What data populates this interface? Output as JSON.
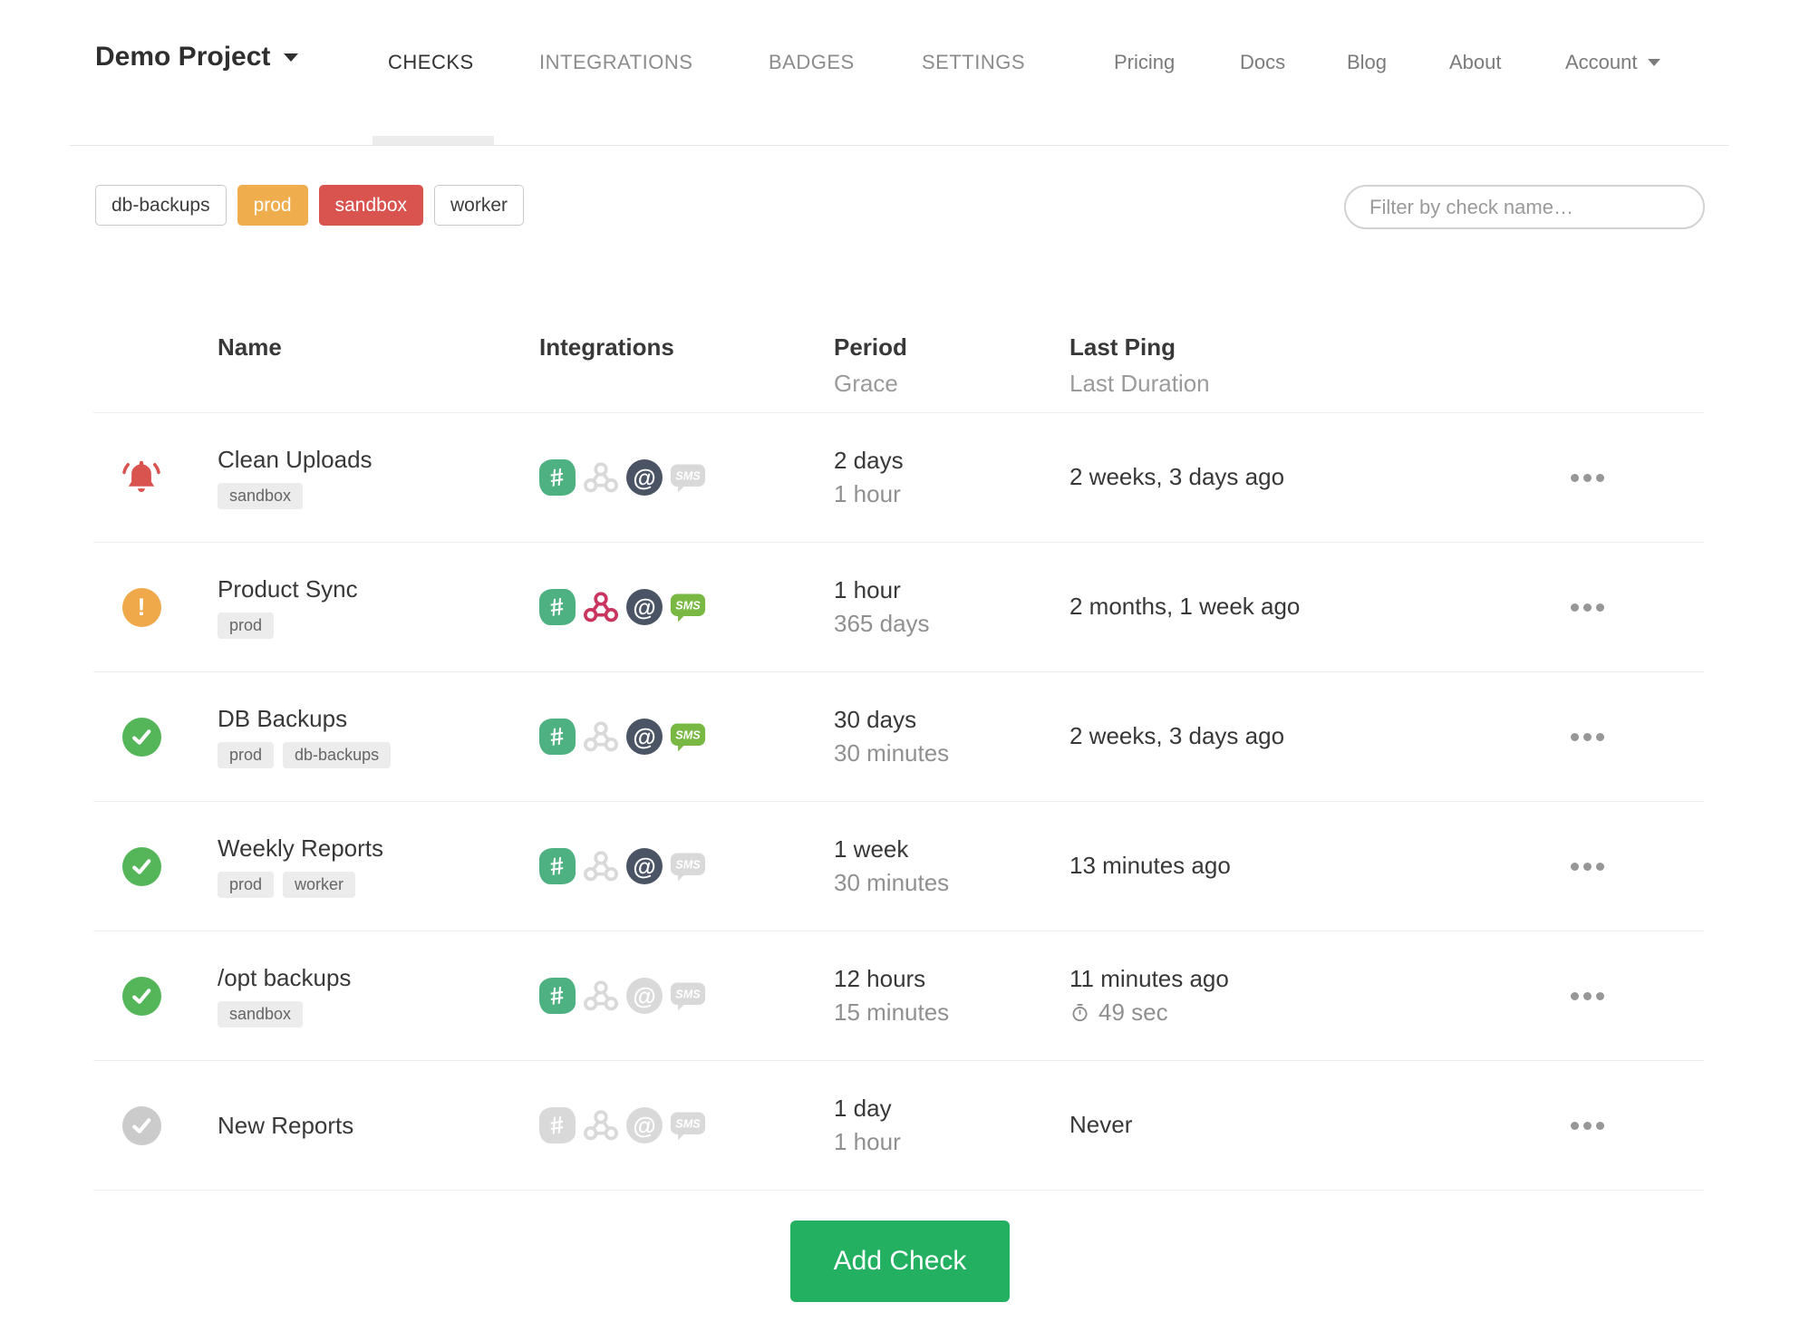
{
  "header": {
    "project": "Demo Project",
    "tabs": [
      "CHECKS",
      "INTEGRATIONS",
      "BADGES",
      "SETTINGS"
    ],
    "active_tab": "CHECKS",
    "links": [
      "Pricing",
      "Docs",
      "Blog",
      "About"
    ],
    "account_label": "Account"
  },
  "filters": {
    "tag_buttons": [
      {
        "label": "db-backups",
        "variant": "outline"
      },
      {
        "label": "prod",
        "variant": "orange"
      },
      {
        "label": "sandbox",
        "variant": "red"
      },
      {
        "label": "worker",
        "variant": "outline"
      }
    ],
    "search_placeholder": "Filter by check name…"
  },
  "table": {
    "headers": {
      "name": "Name",
      "integrations": "Integrations",
      "period": "Period",
      "grace": "Grace",
      "last_ping": "Last Ping",
      "last_duration": "Last Duration"
    },
    "rows": [
      {
        "status": "alert",
        "name": "Clean Uploads",
        "tags": [
          "sandbox"
        ],
        "integrations": {
          "slack": true,
          "webhook": false,
          "email": true,
          "sms": false
        },
        "period": "2 days",
        "grace": "1 hour",
        "last_ping": "2 weeks, 3 days ago",
        "last_duration": ""
      },
      {
        "status": "warning",
        "name": "Product Sync",
        "tags": [
          "prod"
        ],
        "integrations": {
          "slack": true,
          "webhook": true,
          "email": true,
          "sms": true
        },
        "period": "1 hour",
        "grace": "365 days",
        "last_ping": "2 months, 1 week ago",
        "last_duration": ""
      },
      {
        "status": "ok",
        "name": "DB Backups",
        "tags": [
          "prod",
          "db-backups"
        ],
        "integrations": {
          "slack": true,
          "webhook": false,
          "email": true,
          "sms": true
        },
        "period": "30 days",
        "grace": "30 minutes",
        "last_ping": "2 weeks, 3 days ago",
        "last_duration": ""
      },
      {
        "status": "ok",
        "name": "Weekly Reports",
        "tags": [
          "prod",
          "worker"
        ],
        "integrations": {
          "slack": true,
          "webhook": false,
          "email": true,
          "sms": false
        },
        "period": "1 week",
        "grace": "30 minutes",
        "last_ping": "13 minutes ago",
        "last_duration": ""
      },
      {
        "status": "ok",
        "name": "/opt backups",
        "tags": [
          "sandbox"
        ],
        "integrations": {
          "slack": true,
          "webhook": false,
          "email": false,
          "sms": false
        },
        "period": "12 hours",
        "grace": "15 minutes",
        "last_ping": "11 minutes ago",
        "last_duration": "49 sec"
      },
      {
        "status": "new",
        "name": "New Reports",
        "tags": [],
        "integrations": {
          "slack": false,
          "webhook": false,
          "email": false,
          "sms": false
        },
        "period": "1 day",
        "grace": "1 hour",
        "last_ping": "Never",
        "last_duration": ""
      }
    ]
  },
  "actions": {
    "add_check_label": "Add Check"
  },
  "icons": {
    "chevron": "chevron-down-icon",
    "alert": "alert-bell-icon",
    "warning": "warning-exclamation-icon",
    "ok": "ok-check-icon",
    "new": "new-check-icon",
    "slack": "slack-icon",
    "webhook": "webhook-icon",
    "email": "email-at-icon",
    "sms": "sms-bubble-icon",
    "stopwatch": "stopwatch-icon",
    "row_menu": "ellipsis-menu-icon"
  },
  "colors": {
    "alert_red": "#d9534f",
    "warning_orange": "#f0ad4e",
    "ok_green": "#55b559",
    "new_gray": "#cbcbcb",
    "slack_green": "#4eb182",
    "webhook_crimson": "#c9355e",
    "email_navy": "#4a5464",
    "sms_green": "#78b843",
    "disabled_icon": "#d9d9d9",
    "add_button_green": "#23b161",
    "tag_orange": "#f0ad4e",
    "tag_red": "#d9534f"
  }
}
